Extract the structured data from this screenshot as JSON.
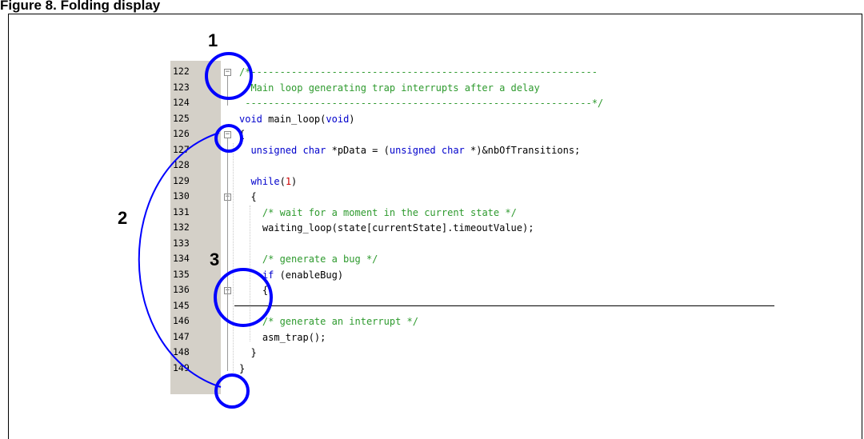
{
  "caption": "Figure 8. Folding display",
  "editor": {
    "lines": [
      {
        "num": "122",
        "segments": [
          {
            "t": "/*------------------------------------------------------------",
            "c": "cm"
          }
        ]
      },
      {
        "num": "123",
        "segments": [
          {
            "t": "  Main loop generating trap interrupts after a delay",
            "c": "cm"
          }
        ]
      },
      {
        "num": "124",
        "segments": [
          {
            "t": " ------------------------------------------------------------*/",
            "c": "cm"
          }
        ]
      },
      {
        "num": "125",
        "segments": [
          {
            "t": "void",
            "c": "kw"
          },
          {
            "t": " main_loop(",
            "c": ""
          },
          {
            "t": "void",
            "c": "kw"
          },
          {
            "t": ")",
            "c": ""
          }
        ]
      },
      {
        "num": "126",
        "segments": [
          {
            "t": "{",
            "c": ""
          }
        ]
      },
      {
        "num": "127",
        "segments": [
          {
            "t": "  ",
            "c": ""
          },
          {
            "t": "unsigned char",
            "c": "kw"
          },
          {
            "t": " *pData = (",
            "c": ""
          },
          {
            "t": "unsigned char",
            "c": "kw"
          },
          {
            "t": " *)&nbOfTransitions;",
            "c": ""
          }
        ]
      },
      {
        "num": "128",
        "segments": []
      },
      {
        "num": "129",
        "segments": [
          {
            "t": "  ",
            "c": ""
          },
          {
            "t": "while",
            "c": "kw"
          },
          {
            "t": "(",
            "c": ""
          },
          {
            "t": "1",
            "c": "num"
          },
          {
            "t": ")",
            "c": ""
          }
        ]
      },
      {
        "num": "130",
        "segments": [
          {
            "t": "  {",
            "c": ""
          }
        ]
      },
      {
        "num": "131",
        "segments": [
          {
            "t": "    ",
            "c": ""
          },
          {
            "t": "/* wait for a moment in the current state */",
            "c": "cm"
          }
        ]
      },
      {
        "num": "132",
        "segments": [
          {
            "t": "    waiting_loop(state[currentState].timeoutValue);",
            "c": ""
          }
        ]
      },
      {
        "num": "133",
        "segments": []
      },
      {
        "num": "134",
        "segments": [
          {
            "t": "    ",
            "c": ""
          },
          {
            "t": "/* generate a bug */",
            "c": "cm"
          }
        ]
      },
      {
        "num": "135",
        "segments": [
          {
            "t": "    ",
            "c": ""
          },
          {
            "t": "if",
            "c": "kw"
          },
          {
            "t": " (enableBug)",
            "c": ""
          }
        ]
      },
      {
        "num": "136",
        "segments": [
          {
            "t": "    {",
            "c": ""
          }
        ]
      },
      {
        "num": "145",
        "segments": []
      },
      {
        "num": "146",
        "segments": [
          {
            "t": "    ",
            "c": ""
          },
          {
            "t": "/* generate an interrupt */",
            "c": "cm"
          }
        ]
      },
      {
        "num": "147",
        "segments": [
          {
            "t": "    asm_trap();",
            "c": ""
          }
        ]
      },
      {
        "num": "148",
        "segments": [
          {
            "t": "  }",
            "c": ""
          }
        ]
      },
      {
        "num": "149",
        "segments": [
          {
            "t": "}",
            "c": ""
          }
        ]
      }
    ],
    "fold_markers": [
      {
        "line": "122",
        "state": "expanded"
      },
      {
        "line": "126",
        "state": "expanded"
      },
      {
        "line": "130",
        "state": "expanded"
      },
      {
        "line": "136",
        "state": "collapsed"
      }
    ]
  },
  "callouts": [
    {
      "label": "1"
    },
    {
      "label": "2"
    },
    {
      "label": "3"
    }
  ],
  "colors": {
    "gutter": "#d4d0c8",
    "keyword": "#0000cc",
    "comment": "#2e9a2e",
    "number": "#cc0000",
    "callout_circle": "#0000ff"
  }
}
